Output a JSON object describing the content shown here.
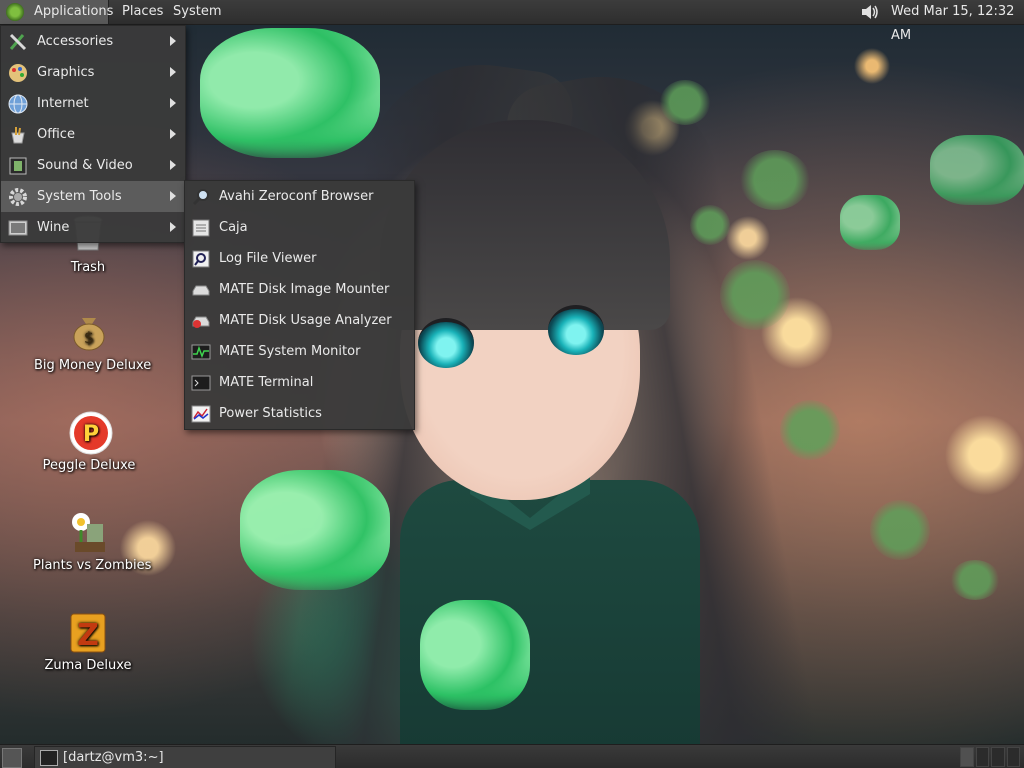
{
  "top_panel": {
    "applications_label": "Applications",
    "places_label": "Places",
    "system_label": "System",
    "volume_icon": "speaker-icon",
    "clock": "Wed Mar 15, 12:32 AM"
  },
  "app_menu": {
    "items": [
      {
        "label": "Accessories",
        "icon": "accessories-icon",
        "has_submenu": true
      },
      {
        "label": "Graphics",
        "icon": "graphics-icon",
        "has_submenu": true
      },
      {
        "label": "Internet",
        "icon": "globe-icon",
        "has_submenu": true
      },
      {
        "label": "Office",
        "icon": "office-icon",
        "has_submenu": true
      },
      {
        "label": "Sound & Video",
        "icon": "film-icon",
        "has_submenu": true
      },
      {
        "label": "System Tools",
        "icon": "gear-icon",
        "has_submenu": true,
        "active": true
      },
      {
        "label": "Wine",
        "icon": "wine-icon",
        "has_submenu": true
      }
    ]
  },
  "system_tools_menu": {
    "items": [
      {
        "label": "Avahi Zeroconf Browser",
        "icon": "magnifier-icon"
      },
      {
        "label": "Caja",
        "icon": "file-manager-icon"
      },
      {
        "label": "Log File Viewer",
        "icon": "log-viewer-icon"
      },
      {
        "label": "MATE Disk Image Mounter",
        "icon": "disk-icon"
      },
      {
        "label": "MATE Disk Usage Analyzer",
        "icon": "disk-usage-icon"
      },
      {
        "label": "MATE System Monitor",
        "icon": "system-monitor-icon"
      },
      {
        "label": "MATE Terminal",
        "icon": "terminal-icon"
      },
      {
        "label": "Power Statistics",
        "icon": "power-stats-icon"
      }
    ]
  },
  "desktop_icons": [
    {
      "label": "Trash",
      "icon": "trash-icon"
    },
    {
      "label": "Big Money Deluxe",
      "icon": "money-bag-icon"
    },
    {
      "label": "Peggle Deluxe",
      "icon": "peggle-icon"
    },
    {
      "label": "Plants vs Zombies",
      "icon": "plants-vs-zombies-icon"
    },
    {
      "label": "Zuma Deluxe",
      "icon": "zuma-icon"
    }
  ],
  "bottom_panel": {
    "task_label": "[dartz@vm3:~]",
    "task_icon": "terminal-icon",
    "show_desktop_icon": "show-desktop-icon"
  },
  "colors": {
    "panel_bg": "#2e2e2e",
    "menu_bg": "#3a3a3a",
    "menu_active": "#5c5c5c",
    "text": "#eaeaea"
  }
}
